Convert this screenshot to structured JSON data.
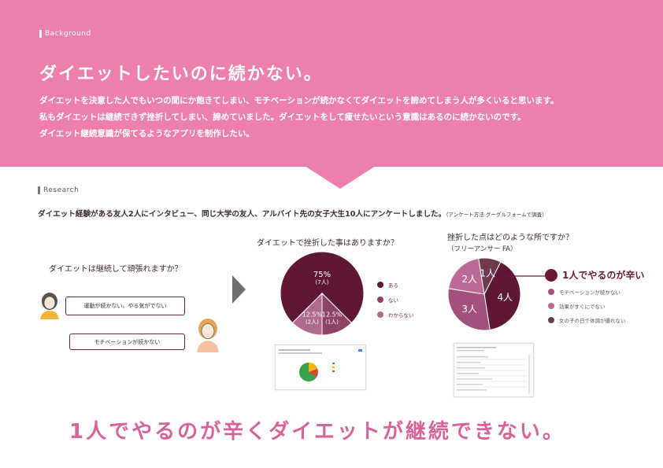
{
  "background": {
    "section_label": "Background",
    "title": "ダイエットしたいのに続かない。",
    "lines": [
      "ダイエットを決意した人でもいつの間にか飽きてしまい、モチベーションが続かなくてダイエットを諦めてしまう人が多くいると思います。",
      "私もダイエットは継続できず挫折してしまい、諦めていました。ダイエットをして痩せたいという意識はあるのに続かないのです。",
      "ダイエット継続意識が保てるようなアプリを制作したい。"
    ]
  },
  "research": {
    "section_label": "Research",
    "description": "ダイエット経験がある友人2人にインタビュー、同じ大学の友人、アルバイト先の女子大生10人にアンケートしました。",
    "method_note": "（アンケート方法:グーグルフォームで調査）",
    "interview": {
      "question": "ダイエットは継続して頑張れますか？",
      "answer1": "運動が続かない。やる気がでない",
      "answer2": "モチベーションが続かない"
    }
  },
  "chart_data": [
    {
      "type": "pie",
      "title": "ダイエットで挫折した事はありますか？",
      "series": [
        {
          "name": "ある",
          "value": 75,
          "label": "75%",
          "count_label": "(7人)",
          "color": "#5e1836"
        },
        {
          "name": "ない",
          "value": 12.5,
          "label": "12.5%",
          "count_label": "(1人)",
          "color": "#8c4366"
        },
        {
          "name": "わからない",
          "value": 12.5,
          "label": "12.5%",
          "count_label": "(2人)",
          "color": "#b06a8e"
        }
      ]
    },
    {
      "type": "pie",
      "title": "挫折した点はどのような所ですか？",
      "subtitle": "（フリーアンサー FA）",
      "series": [
        {
          "name": "1人でやるのが辛い",
          "value": 4,
          "label": "4人",
          "color": "#5e1836"
        },
        {
          "name": "モチベーションが続かない",
          "value": 3,
          "label": "3人",
          "color": "#a3507c"
        },
        {
          "name": "効果がすぐにでない",
          "value": 2,
          "label": "2人",
          "color": "#bd6b96"
        },
        {
          "name": "女の子の日で体調が優れない",
          "value": 1,
          "label": "1人",
          "color": "#6f3a4d"
        }
      ]
    }
  ],
  "conclusion": "1人でやるのが辛くダイエットが継続できない。",
  "colors": {
    "pink_band": "#ec7fab",
    "accent": "#6b1a36",
    "conclusion": "#d6639a"
  }
}
